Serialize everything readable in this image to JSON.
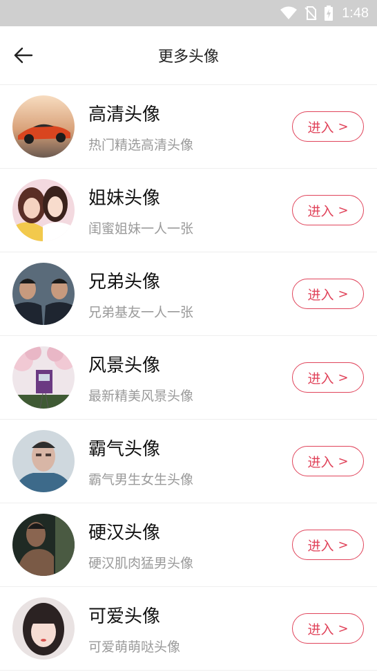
{
  "status_bar": {
    "time": "1:48"
  },
  "header": {
    "title": "更多头像"
  },
  "items": [
    {
      "name": "高清头像",
      "desc": "热门精选高清头像",
      "button": "进入",
      "avatar": "sports-car"
    },
    {
      "name": "姐妹头像",
      "desc": "闺蜜姐妹一人一张",
      "button": "进入",
      "avatar": "two-girls"
    },
    {
      "name": "兄弟头像",
      "desc": "兄弟基友一人一张",
      "button": "进入",
      "avatar": "two-men"
    },
    {
      "name": "风景头像",
      "desc": "最新精美风景头像",
      "button": "进入",
      "avatar": "tram-cherry-blossom"
    },
    {
      "name": "霸气头像",
      "desc": "霸气男生女生头像",
      "button": "进入",
      "avatar": "cool-man"
    },
    {
      "name": "硬汉头像",
      "desc": "硬汉肌肉猛男头像",
      "button": "进入",
      "avatar": "tough-man"
    },
    {
      "name": "可爱头像",
      "desc": "可爱萌萌哒头像",
      "button": "进入",
      "avatar": "cute-girl"
    }
  ],
  "colors": {
    "accent": "#e0435a",
    "status_bar": "#cfcfcf",
    "desc_text": "#9a9a9a"
  },
  "icons": {
    "back": "arrow-left-icon",
    "chevron": "chevron-right-icon"
  }
}
